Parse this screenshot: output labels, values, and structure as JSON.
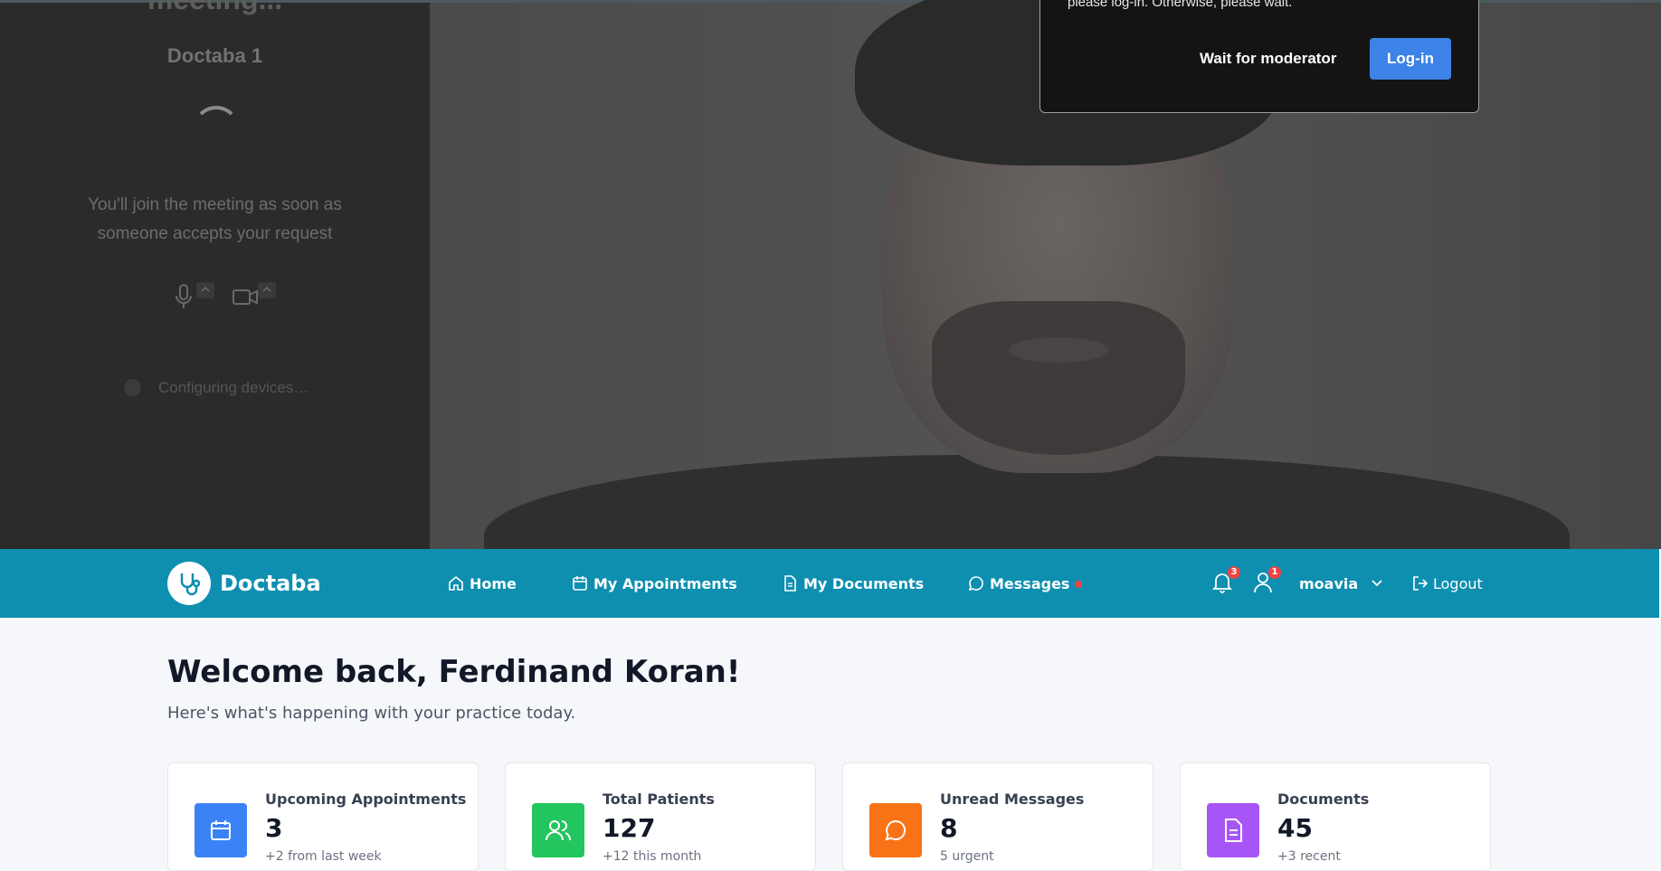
{
  "meeting": {
    "prejoin_heading": "meeting...",
    "room_name": "Doctaba 1",
    "join_message": "You'll join the meeting as soon as someone accepts your request",
    "configuring_text": "Configuring devices…",
    "dialog_text": "please log-in. Otherwise, please wait.",
    "wait_button": "Wait for moderator",
    "login_button": "Log-in"
  },
  "navbar": {
    "brand": "Doctaba",
    "links": [
      {
        "label": "Home",
        "icon": "home-icon"
      },
      {
        "label": "My Appointments",
        "icon": "calendar-icon"
      },
      {
        "label": "My Documents",
        "icon": "document-icon"
      },
      {
        "label": "Messages",
        "icon": "chat-icon"
      }
    ],
    "notifications_count": "3",
    "user_requests_count": "1",
    "username": "moavia",
    "logout": "Logout"
  },
  "dashboard": {
    "welcome": "Welcome back, Ferdinand Koran!",
    "subtitle": "Here's what's happening with your practice today.",
    "cards": [
      {
        "label": "Upcoming Appointments",
        "value": "3",
        "note": "+2 from last week",
        "color": "#3b82f6",
        "icon": "calendar-icon"
      },
      {
        "label": "Total Patients",
        "value": "127",
        "note": "+12 this month",
        "color": "#22c55e",
        "icon": "users-icon"
      },
      {
        "label": "Unread Messages",
        "value": "8",
        "note": "5 urgent",
        "color": "#f97316",
        "icon": "chat-icon"
      },
      {
        "label": "Documents",
        "value": "45",
        "note": "+3 recent",
        "color": "#a855f7",
        "icon": "document-icon"
      }
    ]
  },
  "colors": {
    "navbar": "#0e8fb0",
    "login_button": "#3d82e6",
    "badge": "#ef4444"
  }
}
